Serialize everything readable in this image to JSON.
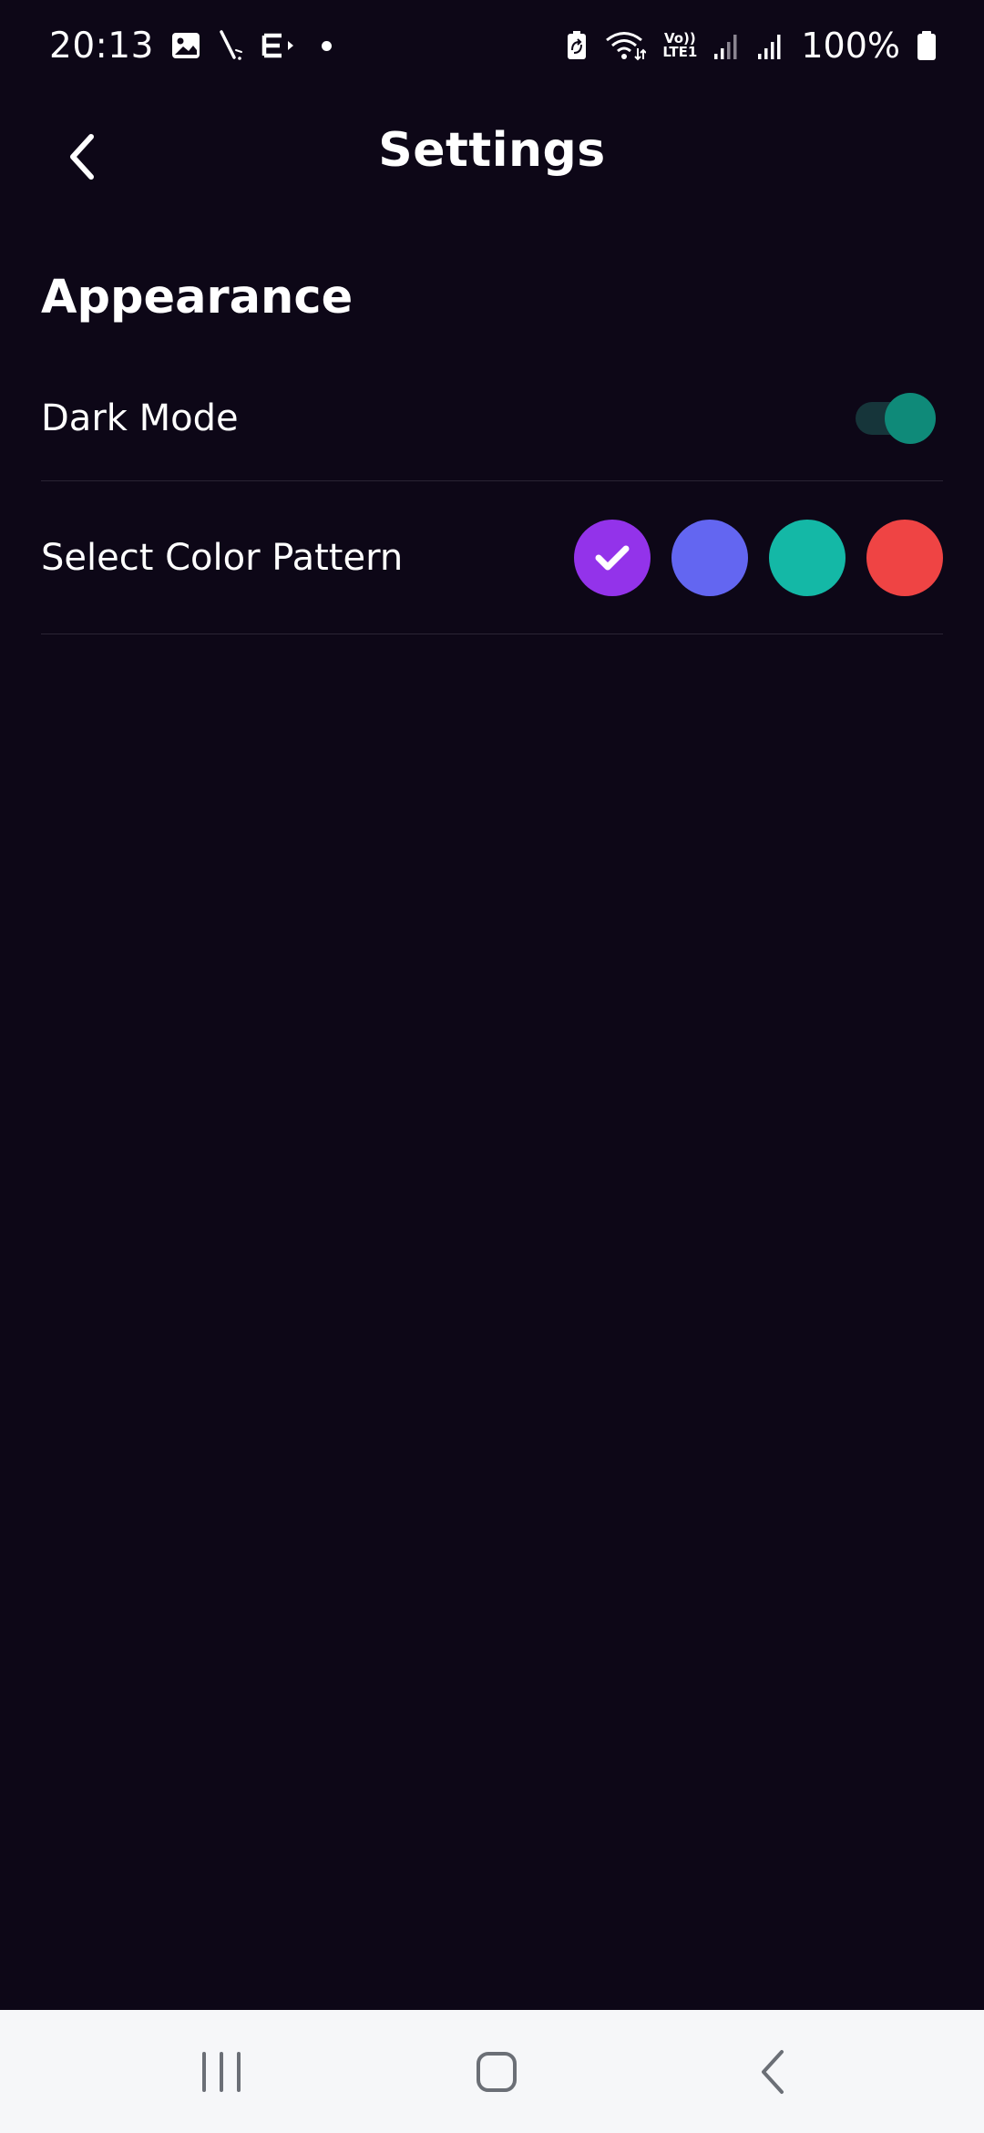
{
  "status_bar": {
    "time": "20:13",
    "lte_top": "Vo))",
    "lte_bottom": "LTE1",
    "battery_percent": "100%",
    "icons": [
      "image-icon",
      "pen-icon",
      "e-app-icon",
      "dot-icon",
      "battery-saver-icon",
      "wifi-icon",
      "lte-icon",
      "signal-icon",
      "signal-icon",
      "battery-icon"
    ]
  },
  "header": {
    "title": "Settings",
    "back_icon": "chevron-left-icon"
  },
  "appearance": {
    "section_title": "Appearance",
    "dark_mode": {
      "label": "Dark Mode",
      "enabled": true
    },
    "color_pattern": {
      "label": "Select Color Pattern",
      "selected_index": 0,
      "options": [
        {
          "color": "#9333ea",
          "selected": true
        },
        {
          "color": "#6366f1",
          "selected": false
        },
        {
          "color": "#14b8a6",
          "selected": false
        },
        {
          "color": "#ef4444",
          "selected": false
        }
      ]
    }
  },
  "colors": {
    "background": "#0d0717",
    "divider": "#2a2434",
    "toggle_thumb": "#0f8a79",
    "toggle_track": "#16353a",
    "nav_bar": "#f6f7f9",
    "nav_icon": "#6b6f76"
  },
  "nav_bar": {
    "buttons": [
      "recents-icon",
      "home-icon",
      "back-icon"
    ]
  }
}
